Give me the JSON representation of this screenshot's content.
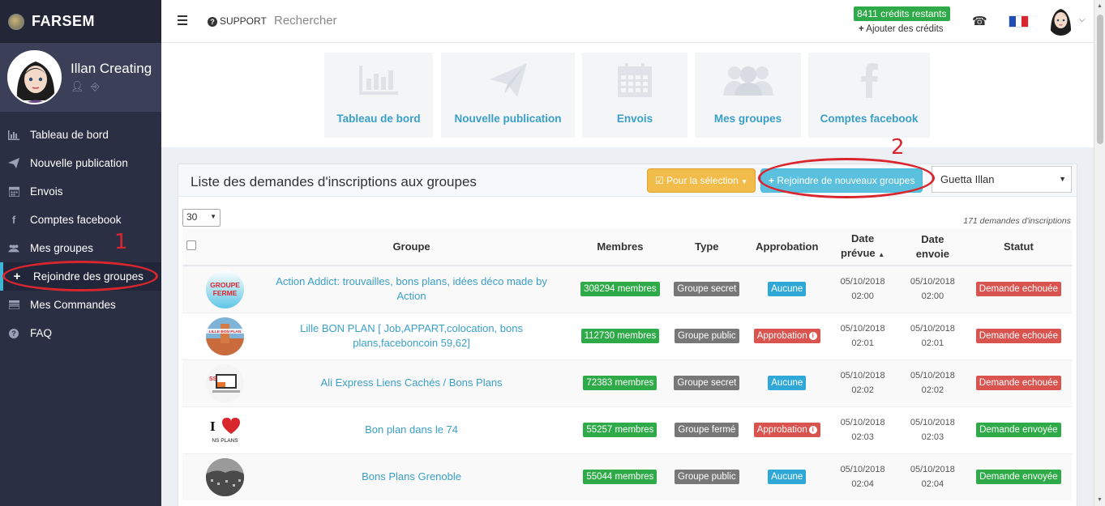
{
  "brand": {
    "name": "FARSEM"
  },
  "user": {
    "name": "Illan Creating"
  },
  "sidebar": {
    "items": [
      {
        "label": "Tableau de bord",
        "icon": "chart-icon"
      },
      {
        "label": "Nouvelle publication",
        "icon": "paper-plane-icon"
      },
      {
        "label": "Envois",
        "icon": "calendar-icon"
      },
      {
        "label": "Comptes facebook",
        "icon": "facebook-icon"
      },
      {
        "label": "Mes groupes",
        "icon": "users-icon"
      },
      {
        "label": "Rejoindre des groupes",
        "icon": "plus-icon",
        "active": true
      },
      {
        "label": "Mes Commandes",
        "icon": "list-icon"
      },
      {
        "label": "FAQ",
        "icon": "question-icon"
      }
    ]
  },
  "topbar": {
    "support": "SUPPORT",
    "search_placeholder": "Rechercher",
    "credits": "8411 crédits restants",
    "add_credits": "Ajouter des crédits"
  },
  "shortcuts": [
    {
      "label": "Tableau de bord"
    },
    {
      "label": "Nouvelle publication"
    },
    {
      "label": "Envois"
    },
    {
      "label": "Mes groupes"
    },
    {
      "label": "Comptes facebook"
    }
  ],
  "annotations": {
    "one": "1",
    "two": "2"
  },
  "panel": {
    "title": "Liste des demandes d'inscriptions aux groupes",
    "btn_selection": "Pour la sélection",
    "btn_join": "Rejoindre de nouveaux groupes",
    "account": "Guetta Illan",
    "page_size": "30",
    "count": "171 demandes d'inscriptions",
    "columns": {
      "groupe": "Groupe",
      "membres": "Membres",
      "type": "Type",
      "approbation": "Approbation",
      "date_prevue_1": "Date",
      "date_prevue_2": "prévue",
      "date_envoie_1": "Date",
      "date_envoie_2": "envoie",
      "statut": "Statut"
    },
    "rows": [
      {
        "name": "Action Addict: trouvailles, bons plans, idées déco made by Action",
        "membres": "308294 membres",
        "type": "Groupe secret",
        "approbation": "Aucune",
        "appr_class": "b-blue",
        "date_prevue": "05/10/2018",
        "heure_prevue": "02:00",
        "date_envoie": "05/10/2018",
        "heure_envoie": "02:00",
        "statut": "Demande echouée",
        "img_text": "GROUPE FERMÉ"
      },
      {
        "name": "Lille BON PLAN [ Job,APPART,colocation, bons plans,faceboncoin 59,62]",
        "membres": "112730 membres",
        "type": "Groupe public",
        "approbation": "Approbation",
        "appr_class": "b-red",
        "date_prevue": "05/10/2018",
        "heure_prevue": "02:01",
        "date_envoie": "05/10/2018",
        "heure_envoie": "02:01",
        "statut": "Demande echouée",
        "img_text": "LILLE BON PLAN"
      },
      {
        "name": "Ali Express Liens Cachés / Bons Plans",
        "membres": "72383 membres",
        "type": "Groupe secret",
        "approbation": "Aucune",
        "appr_class": "b-blue",
        "date_prevue": "05/10/2018",
        "heure_prevue": "02:02",
        "date_envoie": "05/10/2018",
        "heure_envoie": "02:02",
        "statut": "Demande echouée",
        "img_text": ""
      },
      {
        "name": "Bon plan dans le 74",
        "membres": "55257 membres",
        "type": "Groupe fermé",
        "approbation": "Approbation",
        "appr_class": "b-red",
        "date_prevue": "05/10/2018",
        "heure_prevue": "02:03",
        "date_envoie": "05/10/2018",
        "heure_envoie": "02:03",
        "statut": "Demande envoyée",
        "img_text": "NS PLANS"
      },
      {
        "name": "Bons Plans Grenoble",
        "membres": "55044 membres",
        "type": "Groupe public",
        "approbation": "Aucune",
        "appr_class": "b-blue",
        "date_prevue": "05/10/2018",
        "heure_prevue": "02:04",
        "date_envoie": "05/10/2018",
        "heure_envoie": "02:04",
        "statut": "Demande envoyée",
        "img_text": ""
      }
    ]
  }
}
